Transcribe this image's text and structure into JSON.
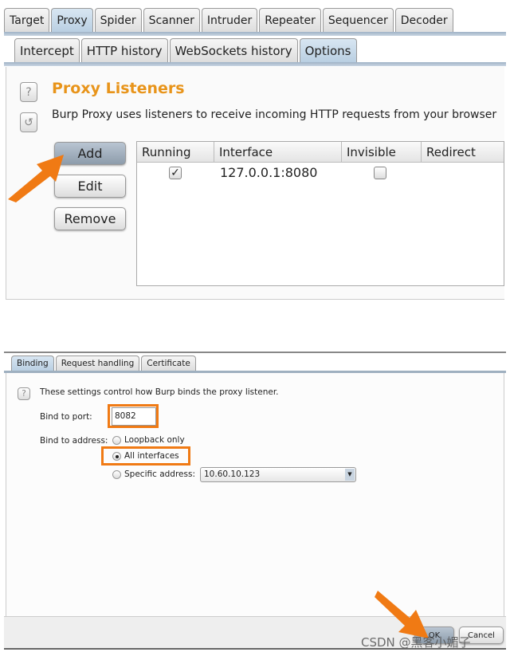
{
  "main_tabs": [
    "Target",
    "Proxy",
    "Spider",
    "Scanner",
    "Intruder",
    "Repeater",
    "Sequencer",
    "Decoder"
  ],
  "main_selected": "Proxy",
  "sub_tabs": [
    "Intercept",
    "HTTP history",
    "WebSockets history",
    "Options"
  ],
  "sub_selected": "Options",
  "section": {
    "title": "Proxy Listeners",
    "description": "Burp Proxy uses listeners to receive incoming HTTP requests from your browser"
  },
  "buttons": {
    "add": "Add",
    "edit": "Edit",
    "remove": "Remove"
  },
  "table": {
    "columns": [
      "Running",
      "Interface",
      "Invisible",
      "Redirect"
    ],
    "rows": [
      {
        "running": true,
        "interface": "127.0.0.1:8080",
        "invisible": false,
        "redirect": ""
      }
    ]
  },
  "dialog": {
    "tabs": [
      "Binding",
      "Request handling",
      "Certificate"
    ],
    "selected_tab": "Binding",
    "help": "These settings control how Burp binds the proxy listener.",
    "port_label": "Bind to port:",
    "port_value": "8082",
    "address_label": "Bind to address:",
    "options": [
      "Loopback only",
      "All interfaces",
      "Specific address:"
    ],
    "selected_option": "All interfaces",
    "specific_address": "10.60.10.123",
    "ok": "OK",
    "cancel": "Cancel"
  },
  "watermark": "CSDN @黑客小媚子",
  "colors": {
    "accent": "#f07a14",
    "title": "#e8941a"
  }
}
